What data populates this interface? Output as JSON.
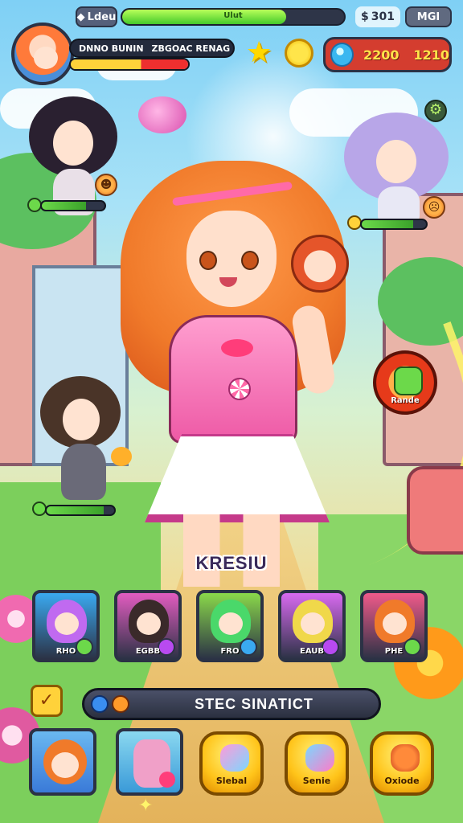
{
  "topbar": {
    "level_icon": "diamond-icon",
    "level_label": "Ldeu",
    "xp_text": "Ulut",
    "xp_fraction": 0.74,
    "coin_label": "301",
    "menu_label": "MGI"
  },
  "player": {
    "name_left": "DNNO BUNIN",
    "name_right": "ZBGOAC RENAG",
    "hp_fraction": 0.6
  },
  "currency": {
    "gem_value_a": "2200",
    "gem_value_b": "1210"
  },
  "hero": {
    "name": "KRESIU"
  },
  "side_action": {
    "label": "Rande",
    "icon": "monster-icon"
  },
  "roster": [
    {
      "label": "RHO",
      "hair": "#c06af0",
      "bg": "#3aa9f0",
      "badge": "#6cd94a"
    },
    {
      "label": "EGBB",
      "hair": "#3a2a2a",
      "bg": "#e25cc0",
      "badge": "#b84af0"
    },
    {
      "label": "FRO",
      "hair": "#4ad86a",
      "bg": "#8ad84a",
      "badge": "#3aa9f0"
    },
    {
      "label": "EAUB",
      "hair": "#f0d84a",
      "bg": "#d86af0",
      "badge": "#b84af0"
    },
    {
      "label": "PHE",
      "hair": "#f07a2a",
      "bg": "#f05a8a",
      "badge": "#6cd94a"
    }
  ],
  "select": {
    "check_icon": "check-icon",
    "label": "STEC SINATICT"
  },
  "bottom": {
    "buttons": [
      {
        "label": "Slebal",
        "icon": "candy-icon"
      },
      {
        "label": "Senie",
        "icon": "heart-icon"
      },
      {
        "label": "Oxiode",
        "icon": "bomb-icon"
      }
    ]
  },
  "colors": {
    "accent_red": "#d43d2f",
    "xp_green": "#45c92a",
    "gold": "#ffd23a"
  }
}
